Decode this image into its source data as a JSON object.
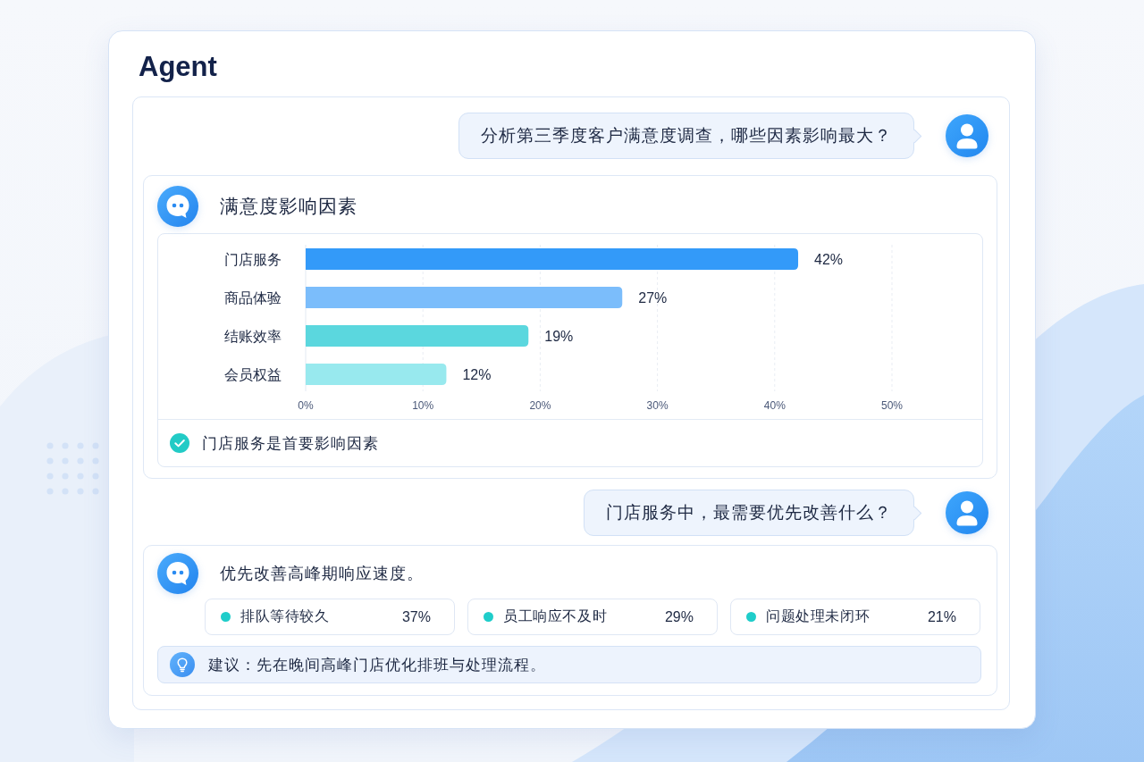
{
  "app": {
    "title": "Agent"
  },
  "conversation": [
    {
      "kind": "user",
      "text": "分析第三季度客户满意度调查，哪些因素影响最大？"
    },
    {
      "kind": "chart_answer",
      "title": "满意度影响因素",
      "chart_data": {
        "type": "bar",
        "orientation": "horizontal",
        "categories": [
          "门店服务",
          "商品体验",
          "结账效率",
          "会员权益"
        ],
        "values": [
          42,
          27,
          19,
          12
        ],
        "xlim": [
          0,
          50
        ],
        "xticks": [
          {
            "value": 0,
            "label": "0%"
          },
          {
            "value": 10,
            "label": "10%"
          },
          {
            "value": 20,
            "label": "20%"
          },
          {
            "value": 30,
            "label": "30%"
          },
          {
            "value": 40,
            "label": "40%"
          },
          {
            "value": 50,
            "label": "50%"
          }
        ],
        "grid": true,
        "value_labels": [
          "42%",
          "27%",
          "19%",
          "12%"
        ]
      },
      "conclusion": "门店服务是首要影响因素"
    },
    {
      "kind": "user",
      "text": "门店服务中，最需要优先改善什么？"
    },
    {
      "kind": "factor_answer",
      "text": "优先改善高峰期响应速度。",
      "factors": [
        {
          "label": "排队等待较久",
          "value": "37%"
        },
        {
          "label": "员工响应不及时",
          "value": "29%"
        },
        {
          "label": "问题处理未闭环",
          "value": "21%"
        }
      ],
      "suggestion": "建议：先在晚间高峰门店优化排班与处理流程。"
    }
  ]
}
